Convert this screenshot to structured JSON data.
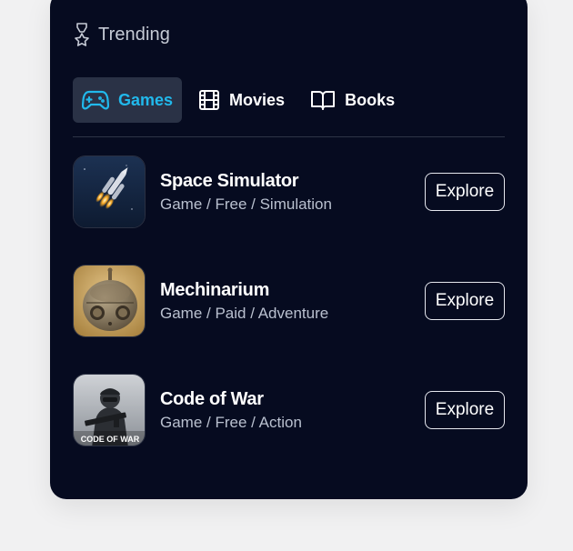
{
  "header": {
    "title": "Trending",
    "icon": "award-ribbon-icon"
  },
  "tabs": [
    {
      "label": "Games",
      "icon": "gamepad-icon",
      "active": true
    },
    {
      "label": "Movies",
      "icon": "film-icon",
      "active": false
    },
    {
      "label": "Books",
      "icon": "book-icon",
      "active": false
    }
  ],
  "items": [
    {
      "title": "Space Simulator",
      "meta": "Game / Free / Simulation",
      "action": "Explore",
      "thumb": "rocket-image"
    },
    {
      "title": "Mechinarium",
      "meta": "Game / Paid / Adventure",
      "action": "Explore",
      "thumb": "robot-image"
    },
    {
      "title": "Code of War",
      "meta": "Game / Free / Action",
      "action": "Explore",
      "thumb": "soldier-image",
      "thumb_text": "CODE OF WAR"
    }
  ],
  "colors": {
    "card_bg": "#060b20",
    "accent": "#21b9ec",
    "active_tab_bg": "#2a3246",
    "text_muted": "#b9c0cf"
  }
}
